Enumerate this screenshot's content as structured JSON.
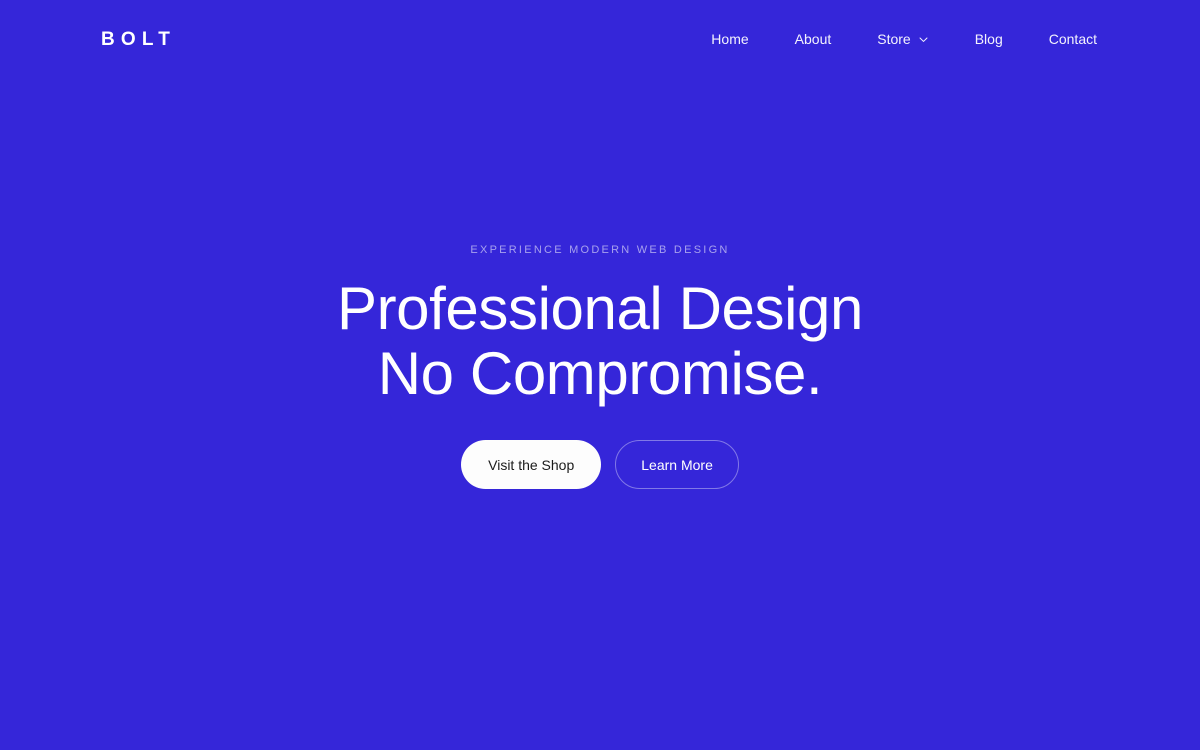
{
  "theme": {
    "background": "#3526D9",
    "text_on_background": "#FFFFFF",
    "eyebrow_color": "rgba(255,255,255,0.56)",
    "primary_button_bg": "#FDFDFD",
    "primary_button_text": "#1B1B1B",
    "secondary_button_border": "rgba(255,255,255,0.38)"
  },
  "header": {
    "brand": "BOLT",
    "nav": [
      {
        "label": "Home",
        "icon": null
      },
      {
        "label": "About",
        "icon": null
      },
      {
        "label": "Store",
        "icon": "chevron-down-icon"
      },
      {
        "label": "Blog",
        "icon": null
      },
      {
        "label": "Contact",
        "icon": null
      }
    ]
  },
  "hero": {
    "eyebrow": "EXPERIENCE MODERN WEB DESIGN",
    "title_line_1": "Professional Design",
    "title_line_2": "No Compromise.",
    "primary_cta": "Visit the Shop",
    "secondary_cta": "Learn More"
  }
}
